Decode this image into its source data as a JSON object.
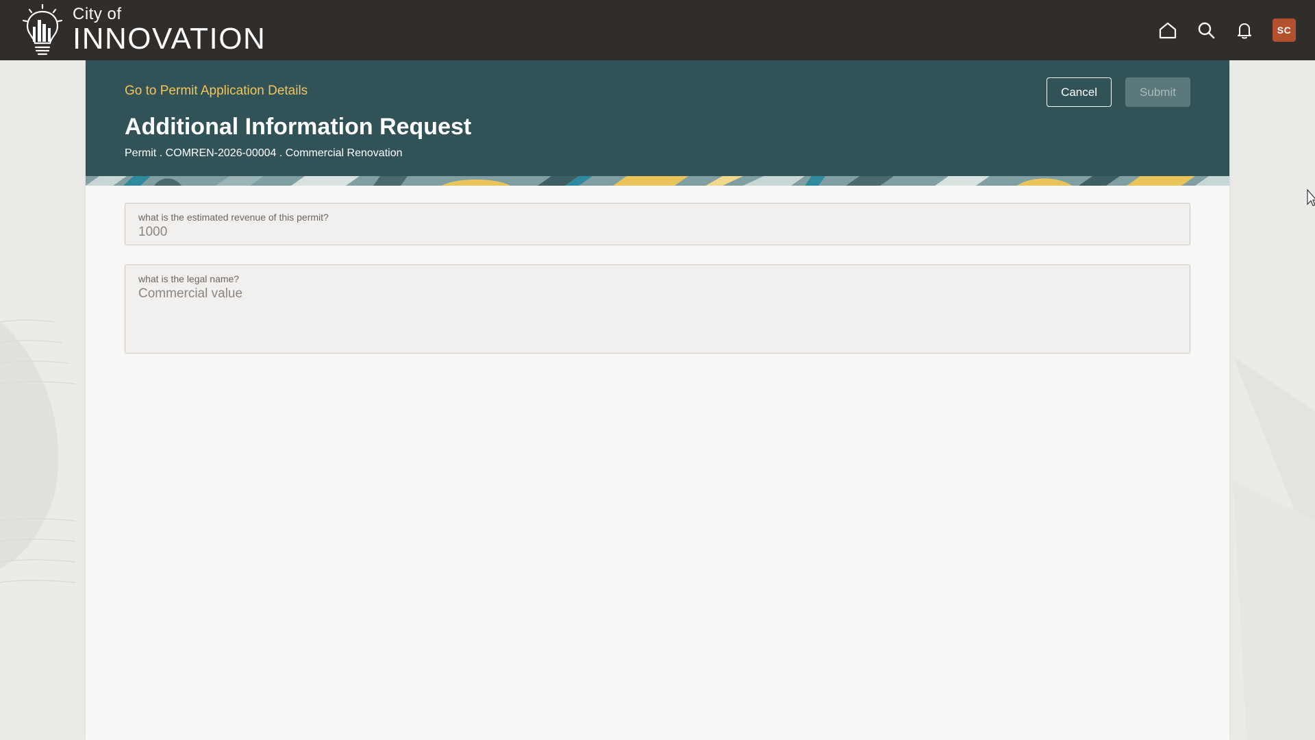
{
  "app": {
    "logo_small": "City of",
    "logo_big": "INNOVATION",
    "avatar_initials": "SC",
    "icons": [
      "bulb-logo-icon",
      "home-icon",
      "search-icon",
      "bell-icon"
    ]
  },
  "header": {
    "back_link": "Go to Permit Application Details",
    "title": "Additional Information Request",
    "subtitle": "Permit . COMREN-2026-00004 . Commercial Renovation",
    "cancel_label": "Cancel",
    "submit_label": "Submit"
  },
  "form": {
    "fields": [
      {
        "label": "what is the estimated revenue of this permit?",
        "value": "1000"
      },
      {
        "label": "what is the legal name?",
        "value": "Commercial value"
      }
    ]
  },
  "colors": {
    "topbar": "#312d2a",
    "header": "#315357",
    "link": "#f3c55a",
    "avatar": "#b3502e",
    "card": "#f9f8f6"
  }
}
